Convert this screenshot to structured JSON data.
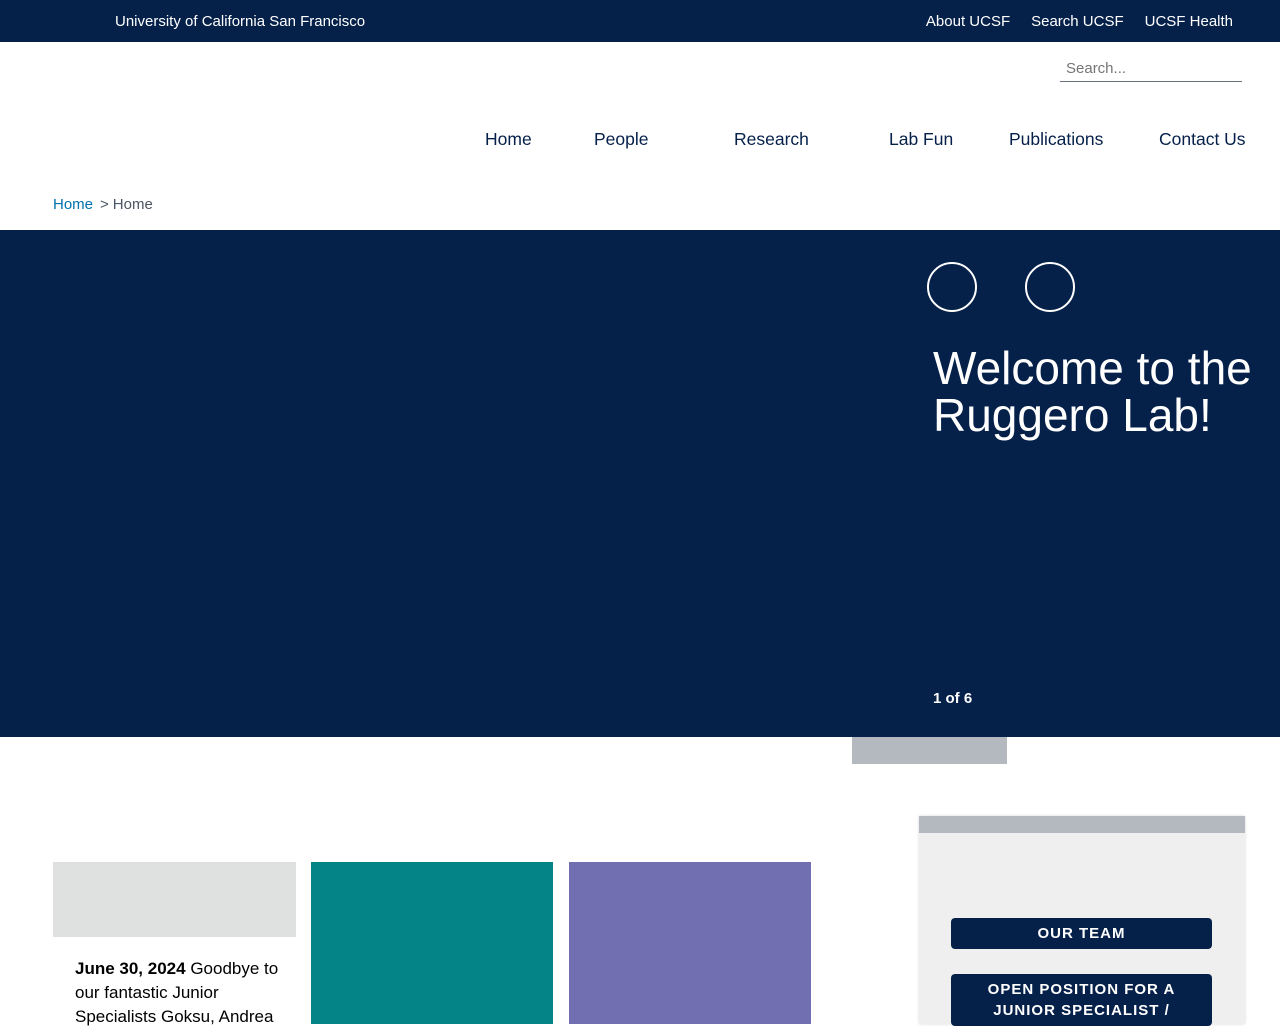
{
  "top_bar": {
    "brand": "University of California San Francisco",
    "links": [
      "About UCSF",
      "Search UCSF",
      "UCSF Health"
    ]
  },
  "search": {
    "placeholder": "Search..."
  },
  "nav": {
    "items": [
      "Home",
      "People",
      "Research",
      "Lab Fun",
      "Publications",
      "Contact Us"
    ]
  },
  "breadcrumb": {
    "link": "Home",
    "separator": ">",
    "current": "Home"
  },
  "hero": {
    "title": "Welcome to the Ruggero Lab!",
    "counter": "1 of 6"
  },
  "news": {
    "date": "June 30, 2024",
    "text": "Goodbye to our fantastic Junior Specialists Goksu, Andrea"
  },
  "sidebar": {
    "buttons": [
      "OUR TEAM",
      "OPEN POSITION FOR A JUNIOR SPECIALIST /"
    ]
  },
  "colors": {
    "navy": "#052049",
    "teal": "#058488",
    "purple": "#716fb2",
    "link_blue": "#0071ad",
    "light_grey": "#dfe0e0",
    "mid_grey": "#b4b9bf"
  }
}
